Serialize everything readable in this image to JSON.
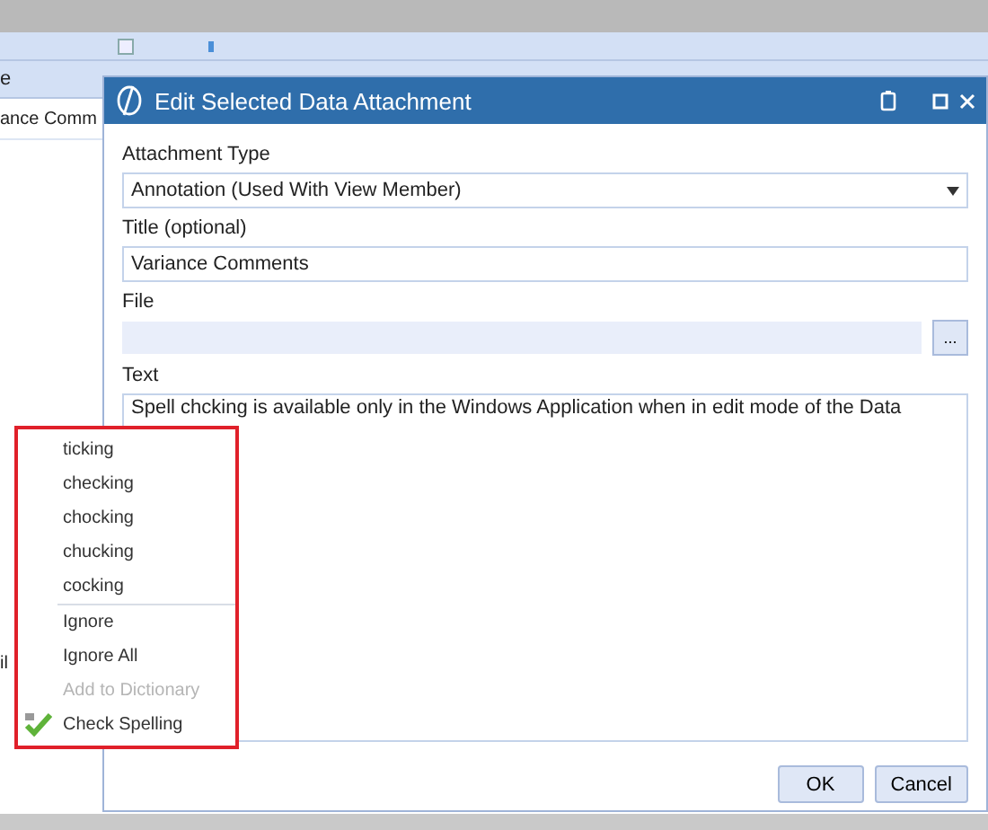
{
  "background": {
    "column_header": "e",
    "row_cell": "ance Comm",
    "side_fragment": "il"
  },
  "dialog": {
    "title": "Edit Selected Data Attachment",
    "fields": [
      {
        "kind": "dropdown",
        "label": "Attachment Type",
        "value": "Annotation (Used With View Member)"
      },
      {
        "kind": "text",
        "label": "Title (optional)",
        "value": "Variance Comments"
      },
      {
        "kind": "file",
        "label": "File",
        "browse": "..."
      },
      {
        "kind": "textarea",
        "label": "Text",
        "value": "Spell chcking is available only in the Windows Application when in edit mode of the Data"
      }
    ],
    "buttons": [
      "OK",
      "Cancel"
    ]
  },
  "context_menu": {
    "groups": [
      [
        {
          "label": "ticking",
          "disabled": false
        },
        {
          "label": "checking",
          "disabled": false
        },
        {
          "label": "chocking",
          "disabled": false
        },
        {
          "label": "chucking",
          "disabled": false
        },
        {
          "label": "cocking",
          "disabled": false
        }
      ],
      [
        {
          "label": "Ignore",
          "disabled": false
        },
        {
          "label": "Ignore All",
          "disabled": false
        },
        {
          "label": "Add to Dictionary",
          "disabled": true
        },
        {
          "label": "Check Spelling",
          "disabled": false,
          "kind": "spell_check"
        }
      ]
    ]
  }
}
